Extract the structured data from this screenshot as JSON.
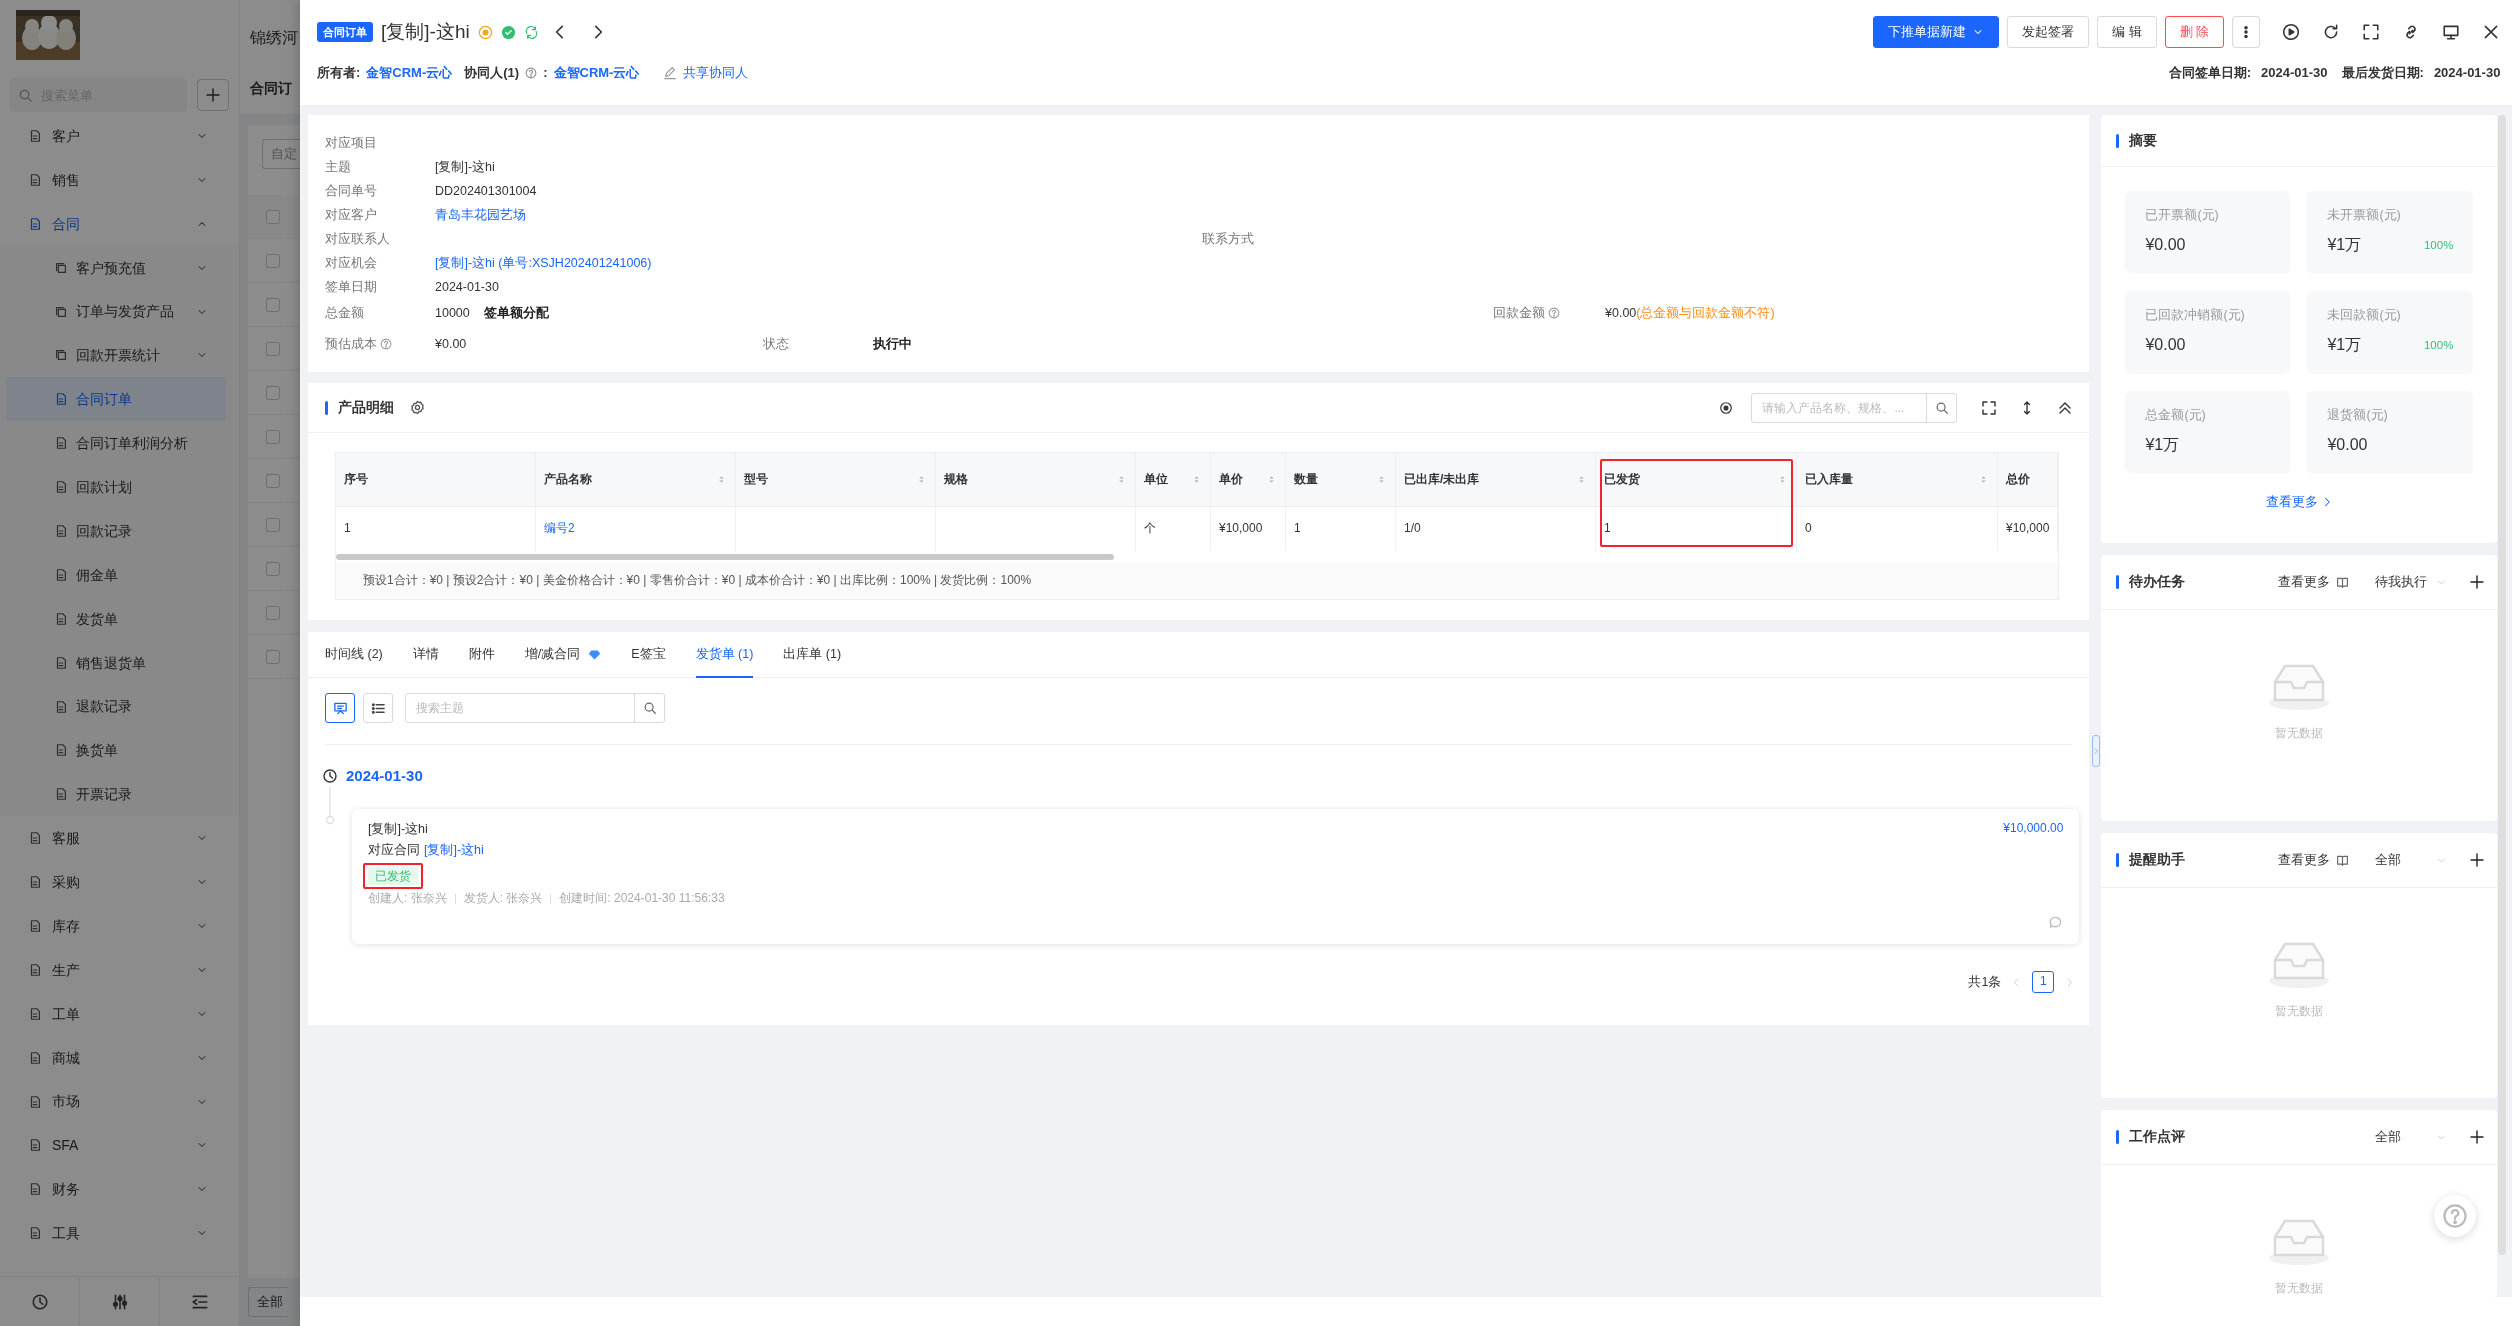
{
  "background_app": {
    "title": "锦绣河",
    "tab": "合同订",
    "filter_button": "自定",
    "footer_button": "全部",
    "rows": [
      {
        "checked": false
      },
      {
        "checked": false
      },
      {
        "checked": false
      },
      {
        "checked": false
      },
      {
        "checked": false
      },
      {
        "checked": false
      },
      {
        "checked": false
      },
      {
        "checked": false
      },
      {
        "checked": false
      },
      {
        "checked": false
      },
      {
        "checked": false
      }
    ]
  },
  "sidebar": {
    "search": {
      "placeholder": "搜索菜单"
    },
    "items": [
      {
        "label": "客户",
        "selected": false,
        "expanded": false
      },
      {
        "label": "销售",
        "selected": false,
        "expanded": false
      },
      {
        "label": "合同",
        "selected": false,
        "expanded": true,
        "children": [
          {
            "label": "客户预充值",
            "selected": false,
            "expanded": false
          },
          {
            "label": "订单与发货产品",
            "selected": false,
            "expanded": false
          },
          {
            "label": "回款开票统计",
            "selected": false,
            "expanded": false
          },
          {
            "label": "合同订单",
            "selected": true
          },
          {
            "label": "合同订单利润分析",
            "selected": false
          },
          {
            "label": "回款计划",
            "selected": false
          },
          {
            "label": "回款记录",
            "selected": false
          },
          {
            "label": "佣金单",
            "selected": false
          },
          {
            "label": "发货单",
            "selected": false
          },
          {
            "label": "销售退货单",
            "selected": false
          },
          {
            "label": "退款记录",
            "selected": false
          },
          {
            "label": "换货单",
            "selected": false
          },
          {
            "label": "开票记录",
            "selected": false
          }
        ]
      },
      {
        "label": "客服",
        "selected": false,
        "expanded": false
      },
      {
        "label": "采购",
        "selected": false,
        "expanded": false
      },
      {
        "label": "库存",
        "selected": false,
        "expanded": false
      },
      {
        "label": "生产",
        "selected": false,
        "expanded": false
      },
      {
        "label": "工单",
        "selected": false,
        "expanded": false
      },
      {
        "label": "商城",
        "selected": false,
        "expanded": false
      },
      {
        "label": "市场",
        "selected": false,
        "expanded": false
      },
      {
        "label": "SFA",
        "selected": false,
        "expanded": false
      },
      {
        "label": "财务",
        "selected": false,
        "expanded": false
      },
      {
        "label": "工具",
        "selected": false,
        "expanded": false
      }
    ]
  },
  "header": {
    "badge": "合同订单",
    "title": "[复制]-这hi",
    "actions": [
      {
        "label": "下推单据新建",
        "kind": "primary"
      },
      {
        "label": "发起签署",
        "kind": "default"
      },
      {
        "label": "编 辑",
        "kind": "default"
      },
      {
        "label": "删 除",
        "kind": "danger"
      }
    ],
    "owner_label": "所有者:",
    "owner": "金智CRM-云心",
    "collaborators_label": "协同人(1)",
    "collaborators_colon": ":",
    "collaborator": "金智CRM-云心",
    "share": "共享协同人",
    "dates": [
      {
        "label": "合同签单日期:",
        "value": "2024-01-30"
      },
      {
        "label": "最后发货日期:",
        "value": "2024-01-30"
      }
    ]
  },
  "info": {
    "fields": [
      {
        "label": "对应项目"
      },
      {
        "label": "主题",
        "kind": "text",
        "value": "[复制]-这hi"
      },
      {
        "label": "合同单号",
        "kind": "text",
        "value": "DD202401301004"
      },
      {
        "label": "对应客户",
        "kind": "link",
        "value": "青岛丰花园艺场"
      },
      {
        "label": "对应联系人",
        "center": {
          "label": "联系方式"
        }
      },
      {
        "label": "对应机会",
        "kind": "link",
        "value": "[复制]-这hi (单号:XSJH202401241006)"
      },
      {
        "label": "签单日期",
        "kind": "text",
        "value": "2024-01-30"
      },
      {
        "label": "总金额",
        "kind": "text",
        "value": "10000",
        "action": "签单额分配",
        "right": {
          "label": "回款金额",
          "help": true,
          "value": "¥0.00",
          "note": "(总金额与回款金额不符)"
        }
      },
      {
        "label": "预估成本",
        "kind": "text",
        "help": true,
        "value": "¥0.00",
        "mid": {
          "label": "状态",
          "value": "执行中"
        }
      }
    ]
  },
  "product_panel": {
    "title": "产品明细",
    "search": {
      "placeholder": "请输入产品名称、规格、..."
    },
    "columns": [
      {
        "title": "序号",
        "kind": "text",
        "sortable": false,
        "highlighted": false
      },
      {
        "title": "产品名称",
        "kind": "link",
        "sortable": true,
        "highlighted": false
      },
      {
        "title": "型号",
        "kind": "text",
        "sortable": true,
        "highlighted": false
      },
      {
        "title": "规格",
        "kind": "text",
        "sortable": true,
        "highlighted": false
      },
      {
        "title": "单位",
        "kind": "text",
        "sortable": true,
        "highlighted": false
      },
      {
        "title": "单价",
        "kind": "text",
        "sortable": true,
        "highlighted": false
      },
      {
        "title": "数量",
        "kind": "text",
        "sortable": true,
        "highlighted": false
      },
      {
        "title": "已出库/未出库",
        "kind": "text",
        "sortable": true,
        "highlighted": false
      },
      {
        "title": "已发货",
        "kind": "text",
        "sortable": true,
        "highlighted": true
      },
      {
        "title": "已入库量",
        "kind": "text",
        "sortable": true,
        "highlighted": false
      },
      {
        "title": "总价",
        "kind": "text",
        "sortable": false,
        "highlighted": false
      }
    ],
    "rows": [
      [
        "1",
        "编号2",
        null,
        null,
        "个",
        "¥10,000",
        "1",
        "1/0",
        "1",
        "0",
        "¥10,000"
      ]
    ],
    "totals": "预设1合计：¥0 | 预设2合计：¥0 | 美金价格合计：¥0 | 零售价合计：¥0 | 成本价合计：¥0 | 出库比例：100% | 发货比例：100%"
  },
  "tabs_panel": {
    "tabs": [
      {
        "label": "时间线 (2)",
        "selected": false,
        "vip": false
      },
      {
        "label": "详情",
        "selected": false,
        "vip": false
      },
      {
        "label": "附件",
        "selected": false,
        "vip": false
      },
      {
        "label": "增/减合同",
        "selected": false,
        "vip": true
      },
      {
        "label": "E签宝",
        "selected": false,
        "vip": false
      },
      {
        "label": "发货单 (1)",
        "selected": true,
        "vip": false
      },
      {
        "label": "出库单 (1)",
        "selected": false,
        "vip": false
      }
    ],
    "views": [
      {
        "kind": "card",
        "selected": true
      },
      {
        "kind": "list",
        "selected": false
      }
    ],
    "search": {
      "placeholder": "搜索主题"
    },
    "timeline": [
      {
        "date": "2024-01-30",
        "entries": [
          {
            "title": "[复制]-这hi",
            "amount": "¥10,000.00",
            "contract_label": "对应合同",
            "contract": "[复制]-这hi",
            "status": "已发货",
            "highlighted": true,
            "meta": [
              "创建人: 张奈兴",
              "发货人: 张奈兴",
              "创建时间: 2024-01-30 11:56:33"
            ]
          }
        ]
      }
    ],
    "pagination": {
      "total": "共1条",
      "pages": [
        {
          "label": "1",
          "selected": true
        }
      ]
    }
  },
  "summary": {
    "title": "摘要",
    "stats": [
      {
        "label": "已开票额(元)",
        "value": "¥0.00"
      },
      {
        "label": "未开票额(元)",
        "value": "¥1万",
        "percent": "100%"
      },
      {
        "label": "已回款冲销额(元)",
        "value": "¥0.00"
      },
      {
        "label": "未回款额(元)",
        "value": "¥1万",
        "percent": "100%"
      },
      {
        "label": "总金额(元)",
        "value": "¥1万"
      },
      {
        "label": "退货额(元)",
        "value": "¥0.00"
      }
    ],
    "more": "查看更多"
  },
  "widgets": [
    {
      "title": "待办任务",
      "more": "查看更多",
      "filter": "待我执行",
      "empty": "暂无数据"
    },
    {
      "title": "提醒助手",
      "more": "查看更多",
      "filter": "全部",
      "empty": "暂无数据"
    },
    {
      "title": "工作点评",
      "filter": "全部",
      "empty": "暂无数据"
    }
  ]
}
